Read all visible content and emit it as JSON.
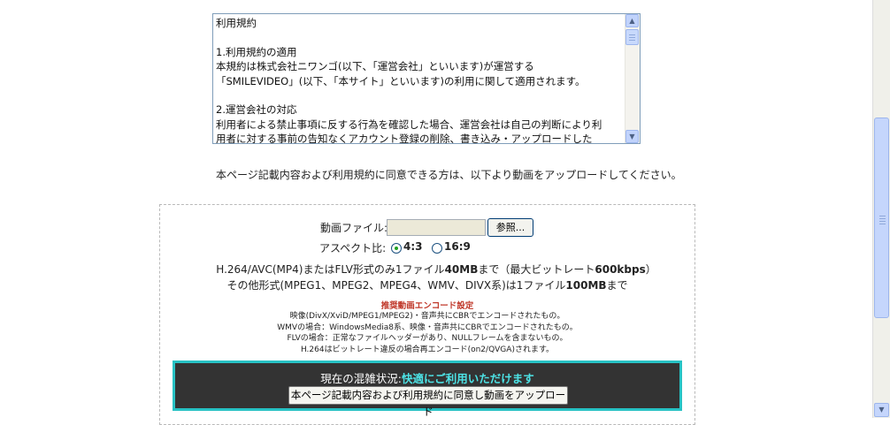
{
  "terms": {
    "line1": "利用規約",
    "line2": "",
    "line3": "1.利用規約の適用",
    "line4": "本規約は株式会社ニワンゴ(以下、「運営会社」といいます)が運営する",
    "line5": "「SMILEVIDEO」(以下、「本サイト」といいます)の利用に関して適用されます。",
    "line6": "",
    "line7": "2.運営会社の対応",
    "line8": "利用者による禁止事項に反する行為を確認した場合、運営会社は自己の判断により利",
    "line9": "用者に対する事前の告知なくアカウント登録の削除、書き込み・アップロードした"
  },
  "notice": "本ページ記載内容および利用規約に同意できる方は、以下より動画をアップロードしてください。",
  "upload": {
    "file_label": "動画ファイル:",
    "browse_label": "参照...",
    "aspect_label": "アスペクト比:",
    "aspect_options": [
      "4:3",
      "16:9"
    ],
    "aspect_selected": "4:3",
    "limit1_a": "H.264/AVC(MP4)またはFLV形式のみ1ファイル",
    "limit1_b": "40MB",
    "limit1_c": "まで（最大ビットレート",
    "limit1_d": "600kbps",
    "limit1_e": "）",
    "limit2_a": "その他形式(MPEG1、MPEG2、MPEG4、WMV、DIVX系)は1ファイル",
    "limit2_b": "100MB",
    "limit2_c": "まで"
  },
  "recommend": {
    "title": "推奨動画エンコード設定",
    "lines": [
      "映像(DivX/XviD/MPEG1/MPEG2)・音声共にCBRでエンコードされたもの。",
      "WMVの場合：WindowsMedia8系、映像・音声共にCBRでエンコードされたもの。",
      "FLVの場合：正常なファイルヘッダーがあり、NULLフレームを含まないもの。",
      "H.264はビットレート違反の場合再エンコード(on2/QVGA)されます。"
    ]
  },
  "status": {
    "label": "現在の混雑状況:",
    "value": "快適にご利用いただけます",
    "button": "本ページ記載内容および利用規約に同意し動画をアップロード"
  },
  "colors": {
    "status_bg": "#333333",
    "status_border": "#27c2c4",
    "status_value": "#4de3e6",
    "recommend_title": "#c0392b"
  }
}
